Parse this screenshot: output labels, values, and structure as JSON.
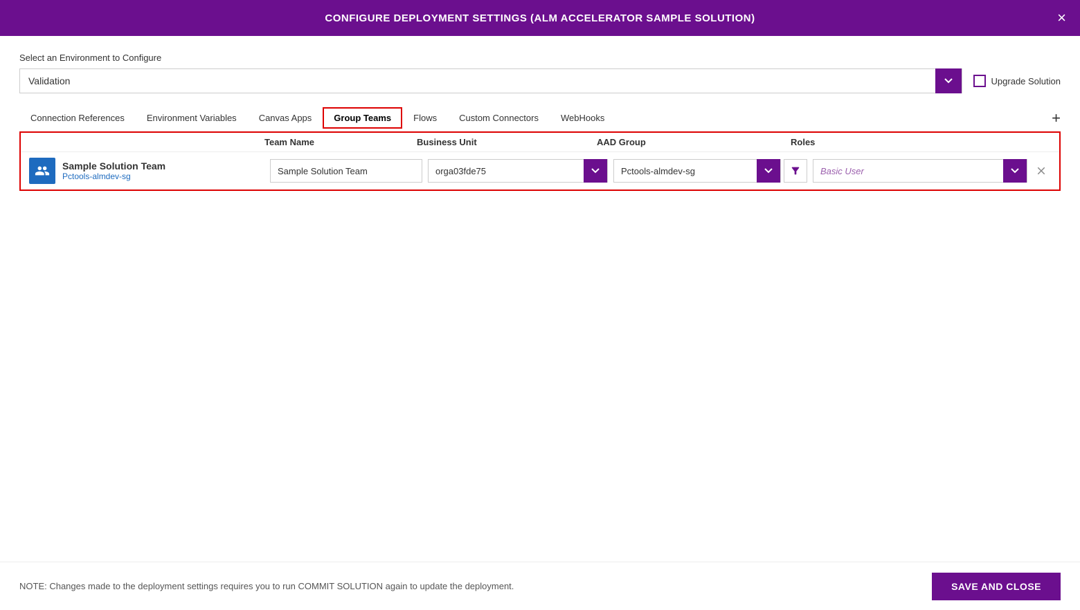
{
  "header": {
    "title": "CONFIGURE DEPLOYMENT SETTINGS (ALM Accelerator Sample Solution)",
    "close_label": "×"
  },
  "env_section": {
    "label": "Select an Environment to Configure",
    "selected_env": "Validation",
    "upgrade_label": "Upgrade Solution"
  },
  "tabs": [
    {
      "id": "connection-references",
      "label": "Connection References",
      "active": false
    },
    {
      "id": "environment-variables",
      "label": "Environment Variables",
      "active": false
    },
    {
      "id": "canvas-apps",
      "label": "Canvas Apps",
      "active": false
    },
    {
      "id": "group-teams",
      "label": "Group Teams",
      "active": true
    },
    {
      "id": "flows",
      "label": "Flows",
      "active": false
    },
    {
      "id": "custom-connectors",
      "label": "Custom Connectors",
      "active": false
    },
    {
      "id": "webhooks",
      "label": "WebHooks",
      "active": false
    }
  ],
  "add_button_label": "+",
  "table": {
    "columns": {
      "team_name": "Team Name",
      "business_unit": "Business Unit",
      "aad_group": "AAD Group",
      "roles": "Roles"
    },
    "rows": [
      {
        "icon_type": "group",
        "team_display_name": "Sample Solution Team",
        "team_sub": "Pctools-almdev-sg",
        "team_name_value": "Sample Solution Team",
        "business_unit_value": "orga03fde75",
        "aad_group_value": "Pctools-almdev-sg",
        "roles_value": "Basic User"
      }
    ]
  },
  "footer": {
    "note": "NOTE: Changes made to the deployment settings requires you to run COMMIT SOLUTION again to update the deployment.",
    "save_close_label": "SAVE AND CLOSE"
  }
}
